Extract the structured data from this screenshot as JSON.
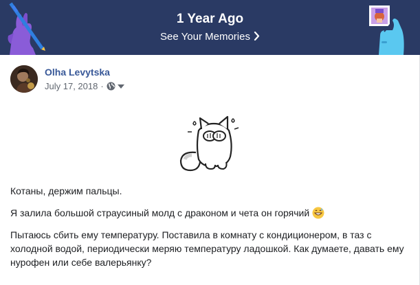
{
  "banner": {
    "title": "1 Year Ago",
    "link_label": "See Your Memories",
    "background_color": "#2a3a64",
    "chevron_icon": "chevron-right-icon"
  },
  "post": {
    "author": "Olha Levytska",
    "date": "July 17, 2018",
    "separator": "·",
    "audience_icon": "globe-icon",
    "menu_icon": "caret-down-icon",
    "sticker": "cat-sticker",
    "paragraphs": [
      "Котаны, держим пальцы.",
      "Я залила большой страусиный молд с драконом и чета он горячий",
      "Пытаюсь сбить ему температуру. Поставила в комнату с кондиционером, в таз с холодной водой, периодически меряю температуру ладошкой. Как думаете, давать ему нурофен или себе валерьянку?"
    ],
    "emoji": "grinning-sweat-emoji",
    "author_color": "#385898"
  }
}
